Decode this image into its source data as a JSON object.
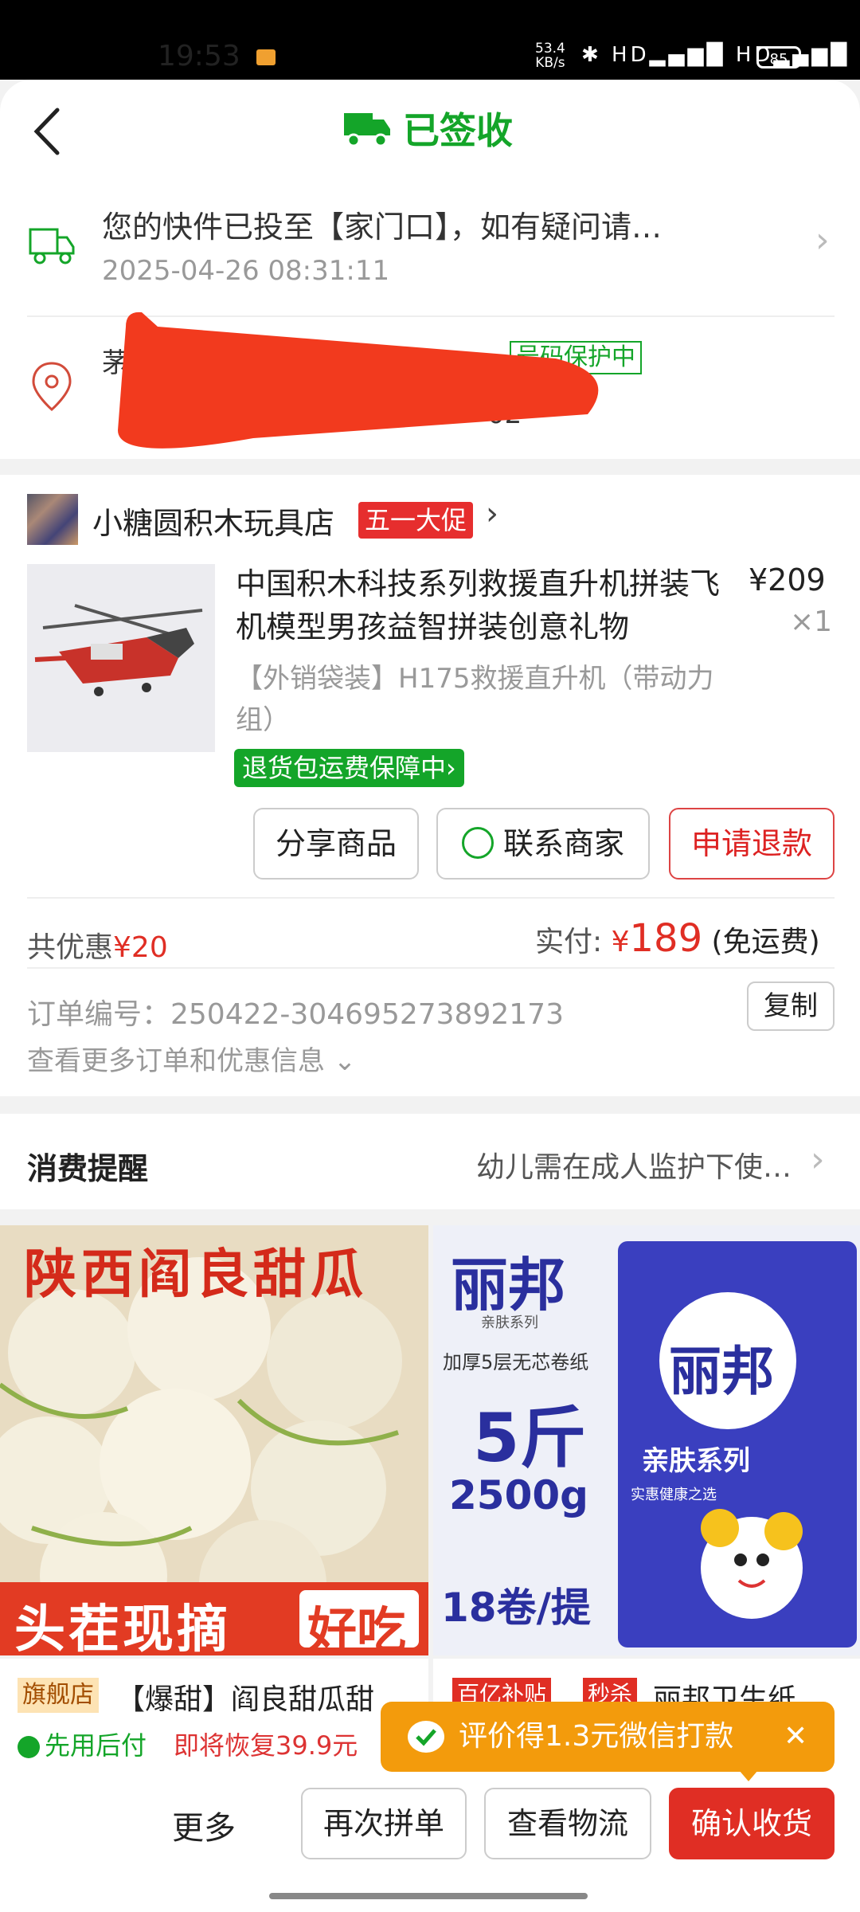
{
  "status_bar": {
    "time": "19:53",
    "net_speed_value": "53.4",
    "net_speed_unit": "KB/s",
    "signal_icons": "✱ HD▂▄▆█ HD▂▄▆█",
    "battery": "85"
  },
  "header": {
    "title": "已签收"
  },
  "tracking": {
    "message": "您的快件已投至【家门口】，如有疑问请…",
    "time": "2025-04-26 08:31:11",
    "chevron": "›"
  },
  "address": {
    "line1_visible_fragment": "茅",
    "line2_visible_fragment": "02",
    "privacy_badge": "号码保护中"
  },
  "shop": {
    "name": "小糖圆积木玩具店",
    "promo_tag": "五一大促",
    "chevron": "›"
  },
  "product": {
    "title": "中国积木科技系列救援直升机拼装飞机模型男孩益智拼装创意礼物",
    "price": "¥209",
    "quantity": "×1",
    "spec": "【外销袋装】H175救援直升机（带动力组）",
    "guarantee": "退货包运费保障中›"
  },
  "actions": {
    "share": "分享商品",
    "contact": "联系商家",
    "refund": "申请退款"
  },
  "payment": {
    "discount_label": "共优惠",
    "discount_amount": "¥20",
    "paid_label": "实付: ",
    "paid_currency": "¥",
    "paid_amount": "189",
    "shipping_note": " (免运费)"
  },
  "order": {
    "number_label": "订单编号：250422-304695273892173",
    "copy": "复制",
    "more_info": "查看更多订单和优惠信息 ⌄"
  },
  "reminder": {
    "title": "消费提醒",
    "text": "幼儿需在成人监护下使…",
    "chevron": "›"
  },
  "recommend": [
    {
      "banner_top": "陕西阎良甜瓜",
      "banner_bottom": "头茬现摘",
      "banner_bottom_tag": "好吃",
      "flag_tag": "旗舰店",
      "name": "【爆甜】阎良甜瓜甜",
      "pay_later": "先用后付",
      "restore_price": "即将恢复39.9元"
    },
    {
      "brand": "丽邦",
      "series_small": "亲肤系列",
      "feature": "加厚5层无芯卷纸",
      "weight": "5斤",
      "grams": "2500g",
      "rolls": "18卷/提",
      "pack_brand": "丽邦",
      "pack_series": "亲肤系列",
      "pack_slogan": "实惠健康之选",
      "tag_subsidy": "百亿补贴",
      "tag_sale": "秒杀",
      "name": "丽邦卫生纸"
    }
  ],
  "toast": {
    "text": "评价得1.3元微信打款",
    "close": "✕"
  },
  "bottom_bar": {
    "more": "更多",
    "reorder": "再次拼单",
    "track": "查看物流",
    "confirm": "确认收货"
  },
  "colors": {
    "green": "#14a529",
    "red": "#e02e24",
    "orange": "#f39b0c"
  }
}
